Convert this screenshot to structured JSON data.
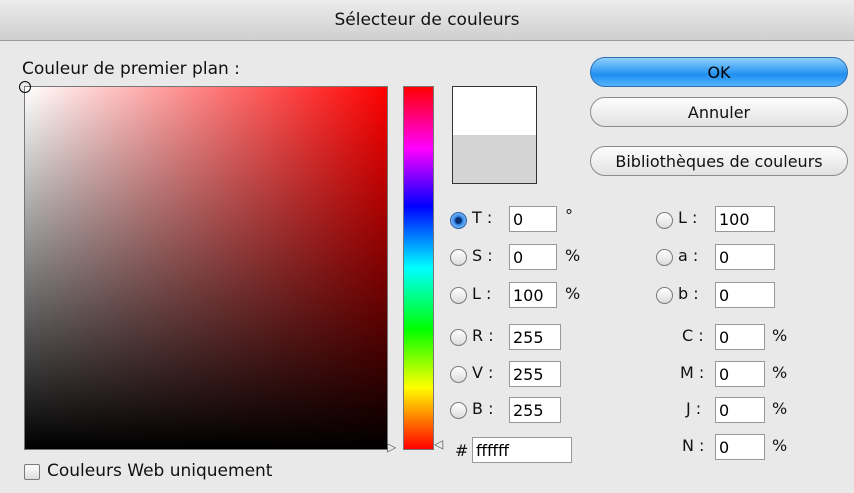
{
  "window": {
    "title": "Sélecteur de couleurs"
  },
  "picker": {
    "label": "Couleur de premier plan :",
    "new_color": "#ffffff",
    "old_color": "#d4d4d4"
  },
  "buttons": {
    "ok": "OK",
    "cancel": "Annuler",
    "libraries": "Bibliothèques de couleurs"
  },
  "hsb": {
    "h": {
      "label": "T :",
      "value": "0",
      "unit": "°"
    },
    "s": {
      "label": "S :",
      "value": "0",
      "unit": "%"
    },
    "b": {
      "label": "L :",
      "value": "100",
      "unit": "%"
    }
  },
  "rgb": {
    "r": {
      "label": "R :",
      "value": "255"
    },
    "g": {
      "label": "V :",
      "value": "255"
    },
    "b": {
      "label": "B :",
      "value": "255"
    }
  },
  "hex": {
    "label": "#",
    "value": "ffffff"
  },
  "lab": {
    "l": {
      "label": "L :",
      "value": "100"
    },
    "a": {
      "label": "a :",
      "value": "0"
    },
    "b": {
      "label": "b :",
      "value": "0"
    }
  },
  "cmyk": {
    "c": {
      "label": "C :",
      "value": "0",
      "unit": "%"
    },
    "m": {
      "label": "M :",
      "value": "0",
      "unit": "%"
    },
    "y": {
      "label": "J :",
      "value": "0",
      "unit": "%"
    },
    "k": {
      "label": "N :",
      "value": "0",
      "unit": "%"
    }
  },
  "web_only": {
    "label": "Couleurs Web uniquement",
    "checked": false
  }
}
